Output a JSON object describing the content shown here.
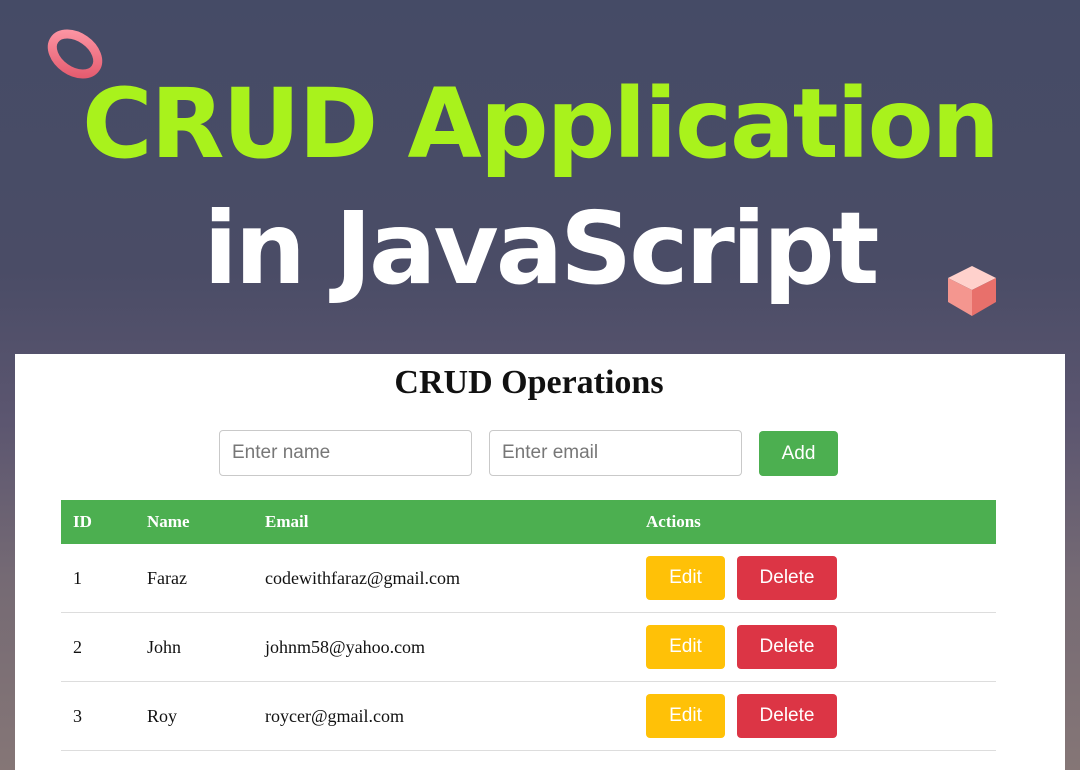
{
  "hero": {
    "line1": "CRUD Application",
    "line2": "in JavaScript"
  },
  "app": {
    "title": "CRUD Operations",
    "name_placeholder": "Enter name",
    "email_placeholder": "Enter email",
    "add_label": "Add",
    "columns": [
      "ID",
      "Name",
      "Email",
      "Actions"
    ],
    "rows": [
      {
        "id": "1",
        "name": "Faraz",
        "email": "codewithfaraz@gmail.com"
      },
      {
        "id": "2",
        "name": "John",
        "email": "johnm58@yahoo.com"
      },
      {
        "id": "3",
        "name": "Roy",
        "email": "roycer@gmail.com"
      }
    ],
    "edit_label": "Edit",
    "delete_label": "Delete"
  },
  "colors": {
    "hero_accent": "#a9f21c",
    "header_green": "#4caf50",
    "add_green": "#4caf50",
    "edit_yellow": "#ffc107",
    "delete_red": "#dc3545"
  },
  "icons": [
    "ring-icon",
    "cube-icon"
  ]
}
